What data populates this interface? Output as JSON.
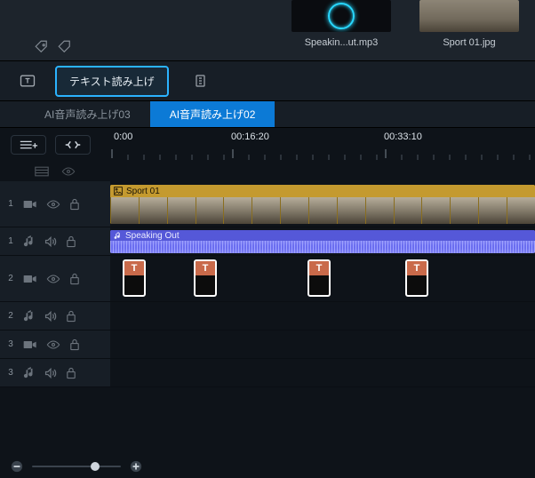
{
  "media": {
    "items": [
      {
        "caption": "Speakin...ut.mp3"
      },
      {
        "caption": "Sport 01.jpg"
      }
    ]
  },
  "toolrow": {
    "tts_label": "テキスト読み上げ"
  },
  "tabs": {
    "left": "AI音声読み上げ03",
    "active": "AI音声読み上げ02"
  },
  "ruler": {
    "t0": "0:00",
    "t1": "00:16:20",
    "t2": "00:33:10"
  },
  "tracks": {
    "rows": [
      {
        "num": "",
        "type": "master"
      },
      {
        "num": "1",
        "type": "video"
      },
      {
        "num": "1",
        "type": "audio"
      },
      {
        "num": "2",
        "type": "video"
      },
      {
        "num": "2",
        "type": "audio"
      },
      {
        "num": "3",
        "type": "video"
      },
      {
        "num": "3",
        "type": "audio"
      }
    ]
  },
  "clips": {
    "video_title": "Sport 01",
    "audio_title": "Speaking Out",
    "text_glyph": "T"
  }
}
